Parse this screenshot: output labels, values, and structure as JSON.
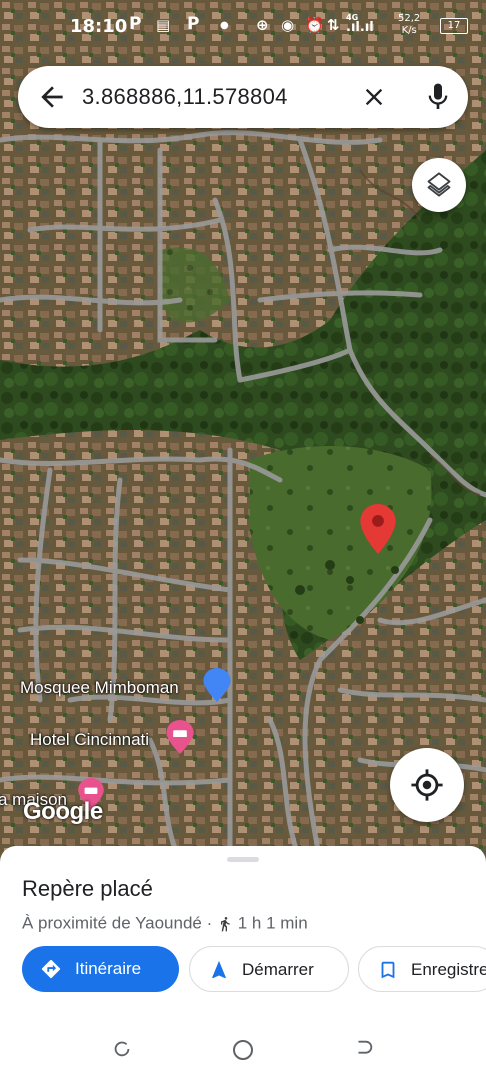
{
  "status_bar": {
    "time": "18:10",
    "icons": [
      "P",
      "P"
    ],
    "network": "4G",
    "speed_value": "52,2",
    "speed_unit": "K/s",
    "battery": "17"
  },
  "search": {
    "query": "3.868886,11.578804",
    "back_icon": "arrow-back-icon",
    "clear_icon": "close-icon",
    "mic_icon": "mic-icon"
  },
  "map": {
    "pois": [
      {
        "label": "Mosquee Mimboman",
        "icon": "mosque-icon",
        "color": "#4285f4"
      },
      {
        "label": "Hotel Cincinnati",
        "icon": "hotel-icon",
        "color": "#e8528d"
      },
      {
        "label": "a maison",
        "icon": "hotel-icon",
        "color": "#e8528d"
      }
    ],
    "marker_color": "#e53935",
    "watermark": "Google"
  },
  "sheet": {
    "title": "Repère placé",
    "subtitle": "À proximité de Yaoundé · ",
    "travel_time": "1 h 1 min",
    "buttons": {
      "directions": "Itinéraire",
      "start": "Démarrer",
      "save": "Enregistrer"
    }
  },
  "colors": {
    "accent": "#1a73e8",
    "text": "#202124",
    "secondary": "#5f6368"
  }
}
